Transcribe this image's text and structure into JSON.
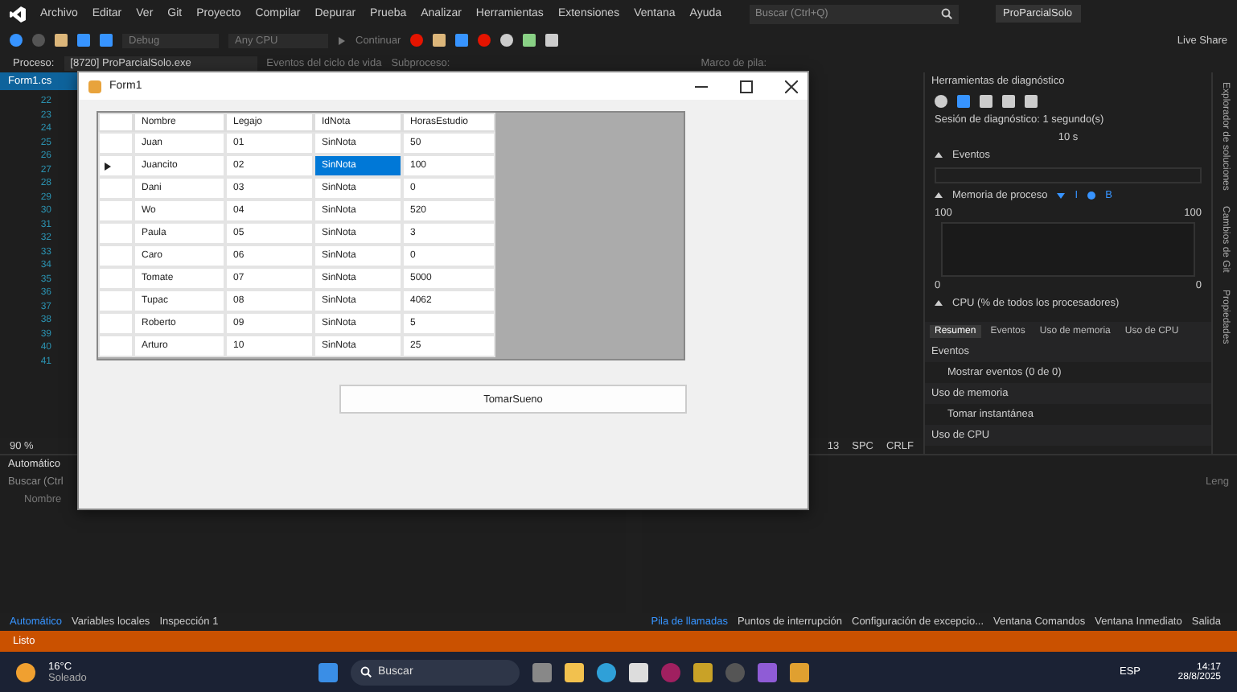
{
  "menu": {
    "items": [
      "Archivo",
      "Editar",
      "Ver",
      "Git",
      "Proyecto",
      "Compilar",
      "Depurar",
      "Prueba",
      "Analizar",
      "Herramientas",
      "Extensiones",
      "Ventana",
      "Ayuda"
    ],
    "search_placeholder": "Buscar (Ctrl+Q)",
    "solution": "ProParcialSolo"
  },
  "toolbar": {
    "configuration": "Debug",
    "platform": "Any CPU",
    "continue": "Continuar",
    "live_share": "Live Share"
  },
  "process_bar": {
    "label": "Proceso:",
    "process": "[8720] ProParcialSolo.exe",
    "lifecycle": "Eventos del ciclo de vida",
    "thread": "Subproceso:",
    "stack": "Marco de pila:"
  },
  "editor": {
    "tab": "Form1.cs",
    "line_numbers": [
      "22",
      "23",
      "24",
      "25",
      "26",
      "27",
      "28",
      "29",
      "30",
      "31",
      "32",
      "33",
      "34",
      "35",
      "36",
      "37",
      "38",
      "39",
      "40",
      "41"
    ],
    "zoom": "90 %",
    "status": [
      "13",
      "SPC",
      "CRLF"
    ]
  },
  "form_window": {
    "title": "Form1",
    "columns": [
      "Nombre",
      "Legajo",
      "IdNota",
      "HorasEstudio"
    ],
    "rows": [
      {
        "cells": [
          "Juan",
          "01",
          "SinNota",
          "50"
        ],
        "selected": false
      },
      {
        "cells": [
          "Juancito",
          "02",
          "SinNota",
          "100"
        ],
        "selected": true
      },
      {
        "cells": [
          "Dani",
          "03",
          "SinNota",
          "0"
        ],
        "selected": false
      },
      {
        "cells": [
          "Wo",
          "04",
          "SinNota",
          "520"
        ],
        "selected": false
      },
      {
        "cells": [
          "Paula",
          "05",
          "SinNota",
          "3"
        ],
        "selected": false
      },
      {
        "cells": [
          "Caro",
          "06",
          "SinNota",
          "0"
        ],
        "selected": false
      },
      {
        "cells": [
          "Tomate",
          "07",
          "SinNota",
          "5000"
        ],
        "selected": false
      },
      {
        "cells": [
          "Tupac",
          "08",
          "SinNota",
          "4062"
        ],
        "selected": false
      },
      {
        "cells": [
          "Roberto",
          "09",
          "SinNota",
          "5"
        ],
        "selected": false
      },
      {
        "cells": [
          "Arturo",
          "10",
          "SinNota",
          "25"
        ],
        "selected": false
      }
    ],
    "button": "TomarSueno"
  },
  "diagnostics": {
    "title": "Herramientas de diagnóstico",
    "session": "Sesión de diagnóstico: 1 segundo(s)",
    "timeline": "10 s",
    "events": "Eventos",
    "memory": "Memoria de proceso",
    "legend": [
      "I",
      "B"
    ],
    "axis": [
      "100",
      "0",
      "100",
      "0"
    ],
    "cpu": "CPU (% de todos los procesadores)",
    "tabs": [
      {
        "label": "Resumen",
        "selected": true
      },
      {
        "label": "Eventos",
        "selected": false
      },
      {
        "label": "Uso de memoria",
        "selected": false
      },
      {
        "label": "Uso de CPU",
        "selected": false
      }
    ],
    "sections": [
      {
        "kind": "heading",
        "text": "Eventos"
      },
      {
        "kind": "action",
        "text": "Mostrar eventos (0 de 0)"
      },
      {
        "kind": "heading",
        "text": "Uso de memoria"
      },
      {
        "kind": "action",
        "text": "Tomar instantánea"
      },
      {
        "kind": "heading",
        "text": "Uso de CPU"
      }
    ]
  },
  "side_tabs": [
    "Explorador de soluciones",
    "Cambios de Git",
    "Propiedades"
  ],
  "locals_panel": {
    "title": "Automático",
    "search_placeholder": "Buscar (Ctrl",
    "column": "Nombre",
    "tabs": [
      {
        "label": "Automático",
        "selected": true
      },
      {
        "label": "Variables locales",
        "selected": false
      },
      {
        "label": "Inspección 1",
        "selected": false
      }
    ]
  },
  "stack_panel": {
    "column": "Leng",
    "tabs": [
      {
        "label": "Pila de llamadas",
        "selected": true
      },
      {
        "label": "Puntos de interrupción",
        "selected": false
      },
      {
        "label": "Configuración de excepcio...",
        "selected": false
      },
      {
        "label": "Ventana Comandos",
        "selected": false
      },
      {
        "label": "Ventana Inmediato",
        "selected": false
      },
      {
        "label": "Salida",
        "selected": false
      }
    ]
  },
  "status_bar": "Listo",
  "taskbar": {
    "weather": "16°C",
    "condition": "Soleado",
    "search": "Buscar",
    "language": "ESP",
    "time": "14:17",
    "date": "28/8/2025"
  }
}
